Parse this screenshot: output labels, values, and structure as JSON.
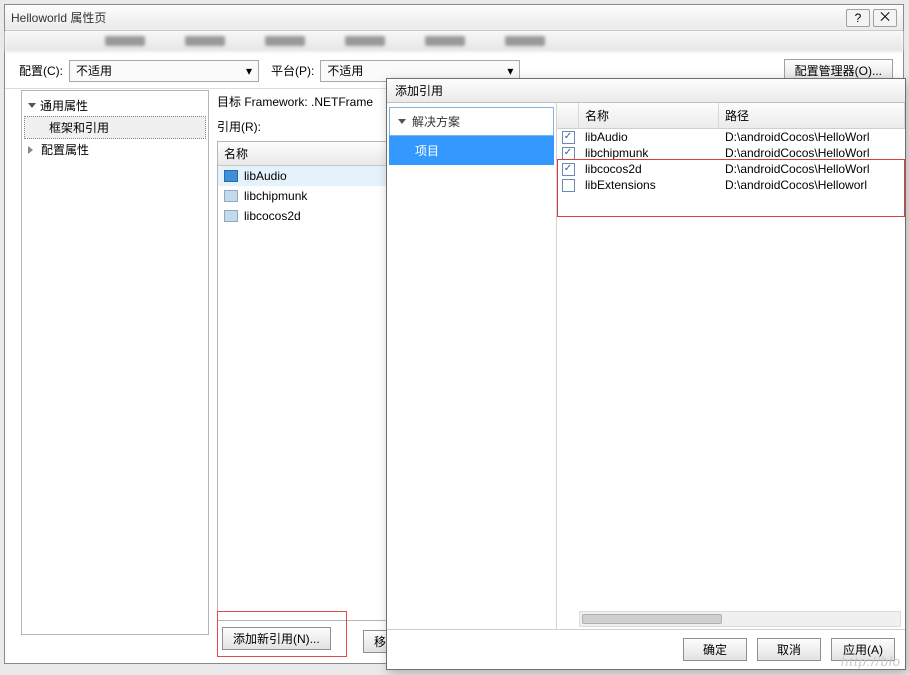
{
  "window": {
    "title": "Helloworld 属性页",
    "help": "?",
    "close": "⨉"
  },
  "config": {
    "label": "配置(C):",
    "value": "不适用",
    "platform_label": "平台(P):",
    "platform_value": "不适用",
    "manager_btn": "配置管理器(O)..."
  },
  "tree": {
    "common": "通用属性",
    "framework": "框架和引用",
    "config_props": "配置属性"
  },
  "mid": {
    "target_label": "目标 Framework:  .NETFrame",
    "ref_label": "引用(R):",
    "name_header": "名称",
    "items": [
      "libAudio",
      "libchipmunk",
      "libcocos2d"
    ],
    "add_ref_btn": "添加新引用(N)...",
    "remove_btn": "移"
  },
  "inner": {
    "title": "添加引用",
    "solution": "解决方案",
    "project": "项目",
    "col_name": "名称",
    "col_path": "路径",
    "rows": [
      {
        "name": "libAudio",
        "path": "D:\\androidCocos\\HelloWorl",
        "checked": true
      },
      {
        "name": "libchipmunk",
        "path": "D:\\androidCocos\\HelloWorl",
        "checked": true
      },
      {
        "name": "libcocos2d",
        "path": "D:\\androidCocos\\HelloWorl",
        "checked": true
      },
      {
        "name": "libExtensions",
        "path": "D:\\androidCocos\\Helloworl",
        "checked": false
      }
    ],
    "ok": "确定",
    "cancel": "取消",
    "apply": "应用(A)"
  },
  "watermark": "http://blo"
}
